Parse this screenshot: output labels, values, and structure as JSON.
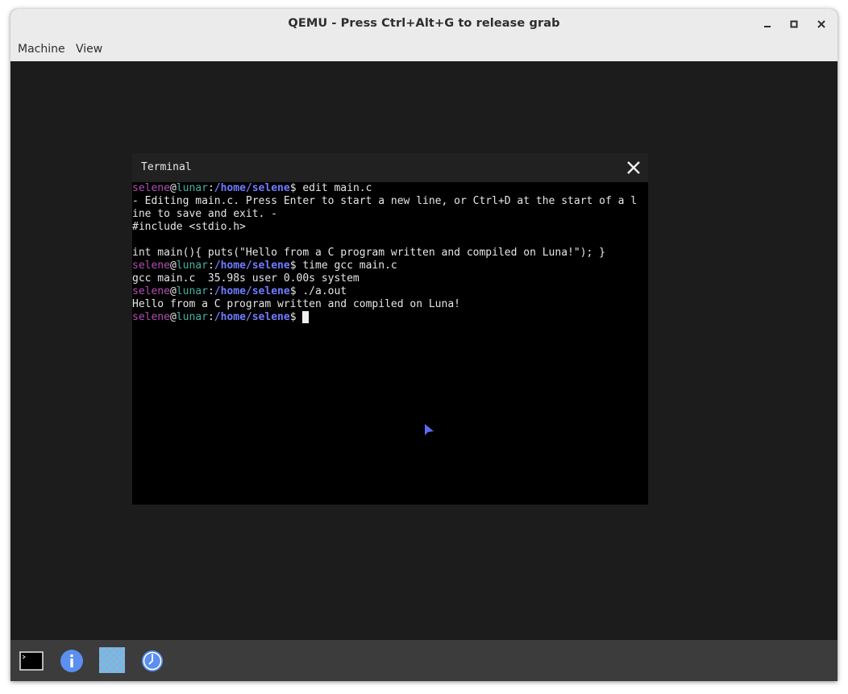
{
  "window": {
    "title": "QEMU - Press Ctrl+Alt+G to release grab",
    "menu": [
      "Machine",
      "View"
    ]
  },
  "terminal": {
    "title": "Terminal",
    "prompt": {
      "user": "selene",
      "at": "@",
      "host": "lunar",
      "colon": ":",
      "path": "/home/selene",
      "dollar": "$ "
    },
    "lines": [
      {
        "type": "prompt",
        "cmd": "edit main.c"
      },
      {
        "type": "text",
        "text": "- Editing main.c. Press Enter to start a new line, or Ctrl+D at the start of a l"
      },
      {
        "type": "text",
        "text": "ine to save and exit. -"
      },
      {
        "type": "text",
        "text": "#include <stdio.h>"
      },
      {
        "type": "text",
        "text": ""
      },
      {
        "type": "text",
        "text": "int main(){ puts(\"Hello from a C program written and compiled on Luna!\"); }"
      },
      {
        "type": "prompt",
        "cmd": "time gcc main.c"
      },
      {
        "type": "text",
        "text": "gcc main.c  35.98s user 0.00s system"
      },
      {
        "type": "prompt",
        "cmd": "./a.out"
      },
      {
        "type": "text",
        "text": "Hello from a C program written and compiled on Luna!"
      },
      {
        "type": "prompt",
        "cmd": "",
        "cursor": true
      }
    ]
  },
  "taskbar": {
    "items": [
      {
        "name": "terminal-app-icon"
      },
      {
        "name": "info-app-icon"
      },
      {
        "name": "checkerboard-app-icon"
      },
      {
        "name": "clock-app-icon"
      }
    ]
  },
  "colors": {
    "prompt_user": "#b34fb3",
    "prompt_host": "#45b0a3",
    "prompt_path": "#6f7cff",
    "terminal_bg": "#000000",
    "screen_bg": "#1c1c1c",
    "taskbar_bg": "#3c3c3c"
  }
}
